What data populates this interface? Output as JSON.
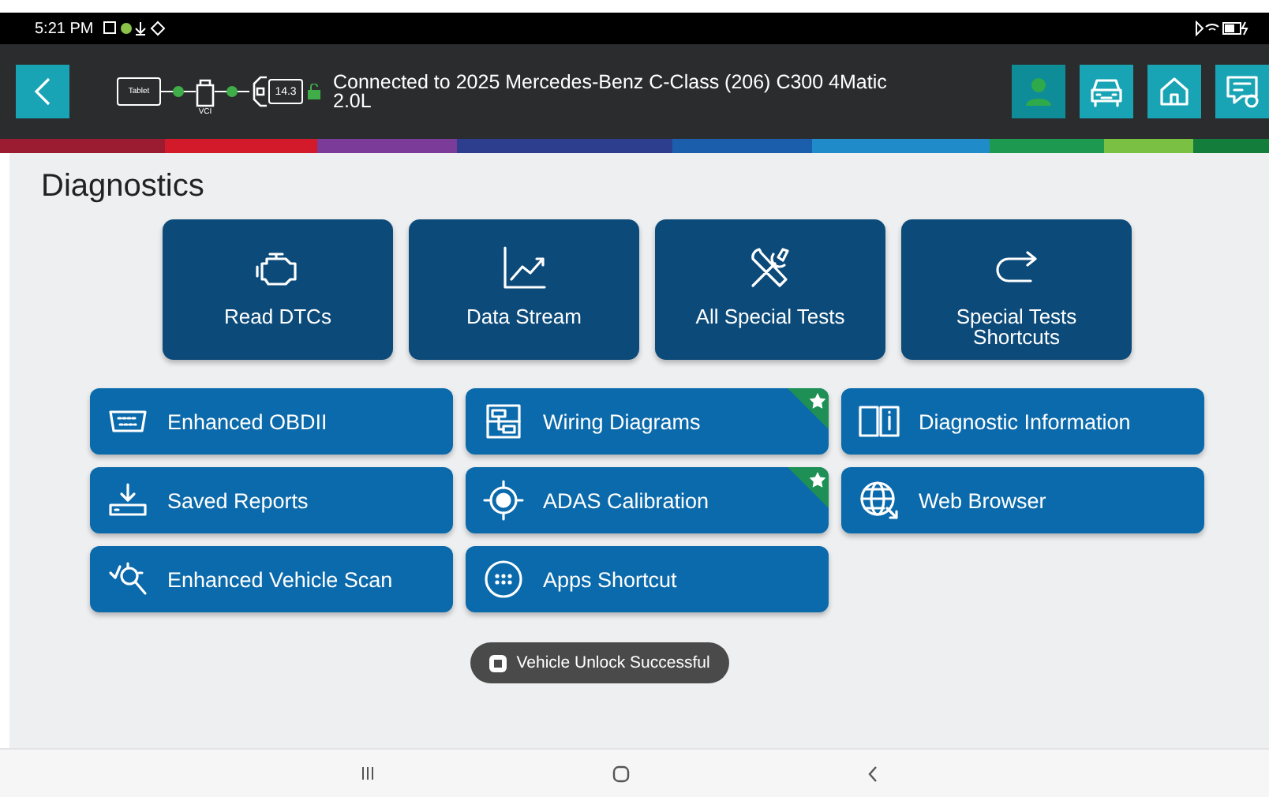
{
  "status_bar": {
    "time": "5:21 PM"
  },
  "header": {
    "connection": {
      "tablet_label": "Tablet",
      "vci_label": "VCI",
      "battery_voltage": "14.3",
      "text": "Connected to 2025 Mercedes-Benz C-Class (206) C300 4Matic 2.0L"
    },
    "actions": [
      {
        "kind": "profile",
        "selected": true
      },
      {
        "kind": "vehicle",
        "selected": false
      },
      {
        "kind": "home",
        "selected": false
      },
      {
        "kind": "feedback",
        "selected": false
      }
    ]
  },
  "page": {
    "title": "Diagnostics"
  },
  "tiles": [
    {
      "kind": "engine",
      "label": "Read DTCs"
    },
    {
      "kind": "chart",
      "label": "Data Stream"
    },
    {
      "kind": "tools",
      "label": "All Special Tests"
    },
    {
      "kind": "redirect",
      "label": "Special Tests Shortcuts"
    }
  ],
  "buttons": [
    {
      "kind": "obd",
      "label": "Enhanced OBDII",
      "featured": false
    },
    {
      "kind": "wiring",
      "label": "Wiring Diagrams",
      "featured": true
    },
    {
      "kind": "book",
      "label": "Diagnostic Information",
      "featured": false
    },
    {
      "kind": "download",
      "label": "Saved Reports",
      "featured": false
    },
    {
      "kind": "target",
      "label": "ADAS Calibration",
      "featured": true
    },
    {
      "kind": "globe",
      "label": "Web Browser",
      "featured": false
    },
    {
      "kind": "scan",
      "label": "Enhanced Vehicle Scan",
      "featured": false
    },
    {
      "kind": "apps",
      "label": "Apps Shortcut",
      "featured": false
    }
  ],
  "toast": {
    "text": "Vehicle Unlock Successful"
  }
}
